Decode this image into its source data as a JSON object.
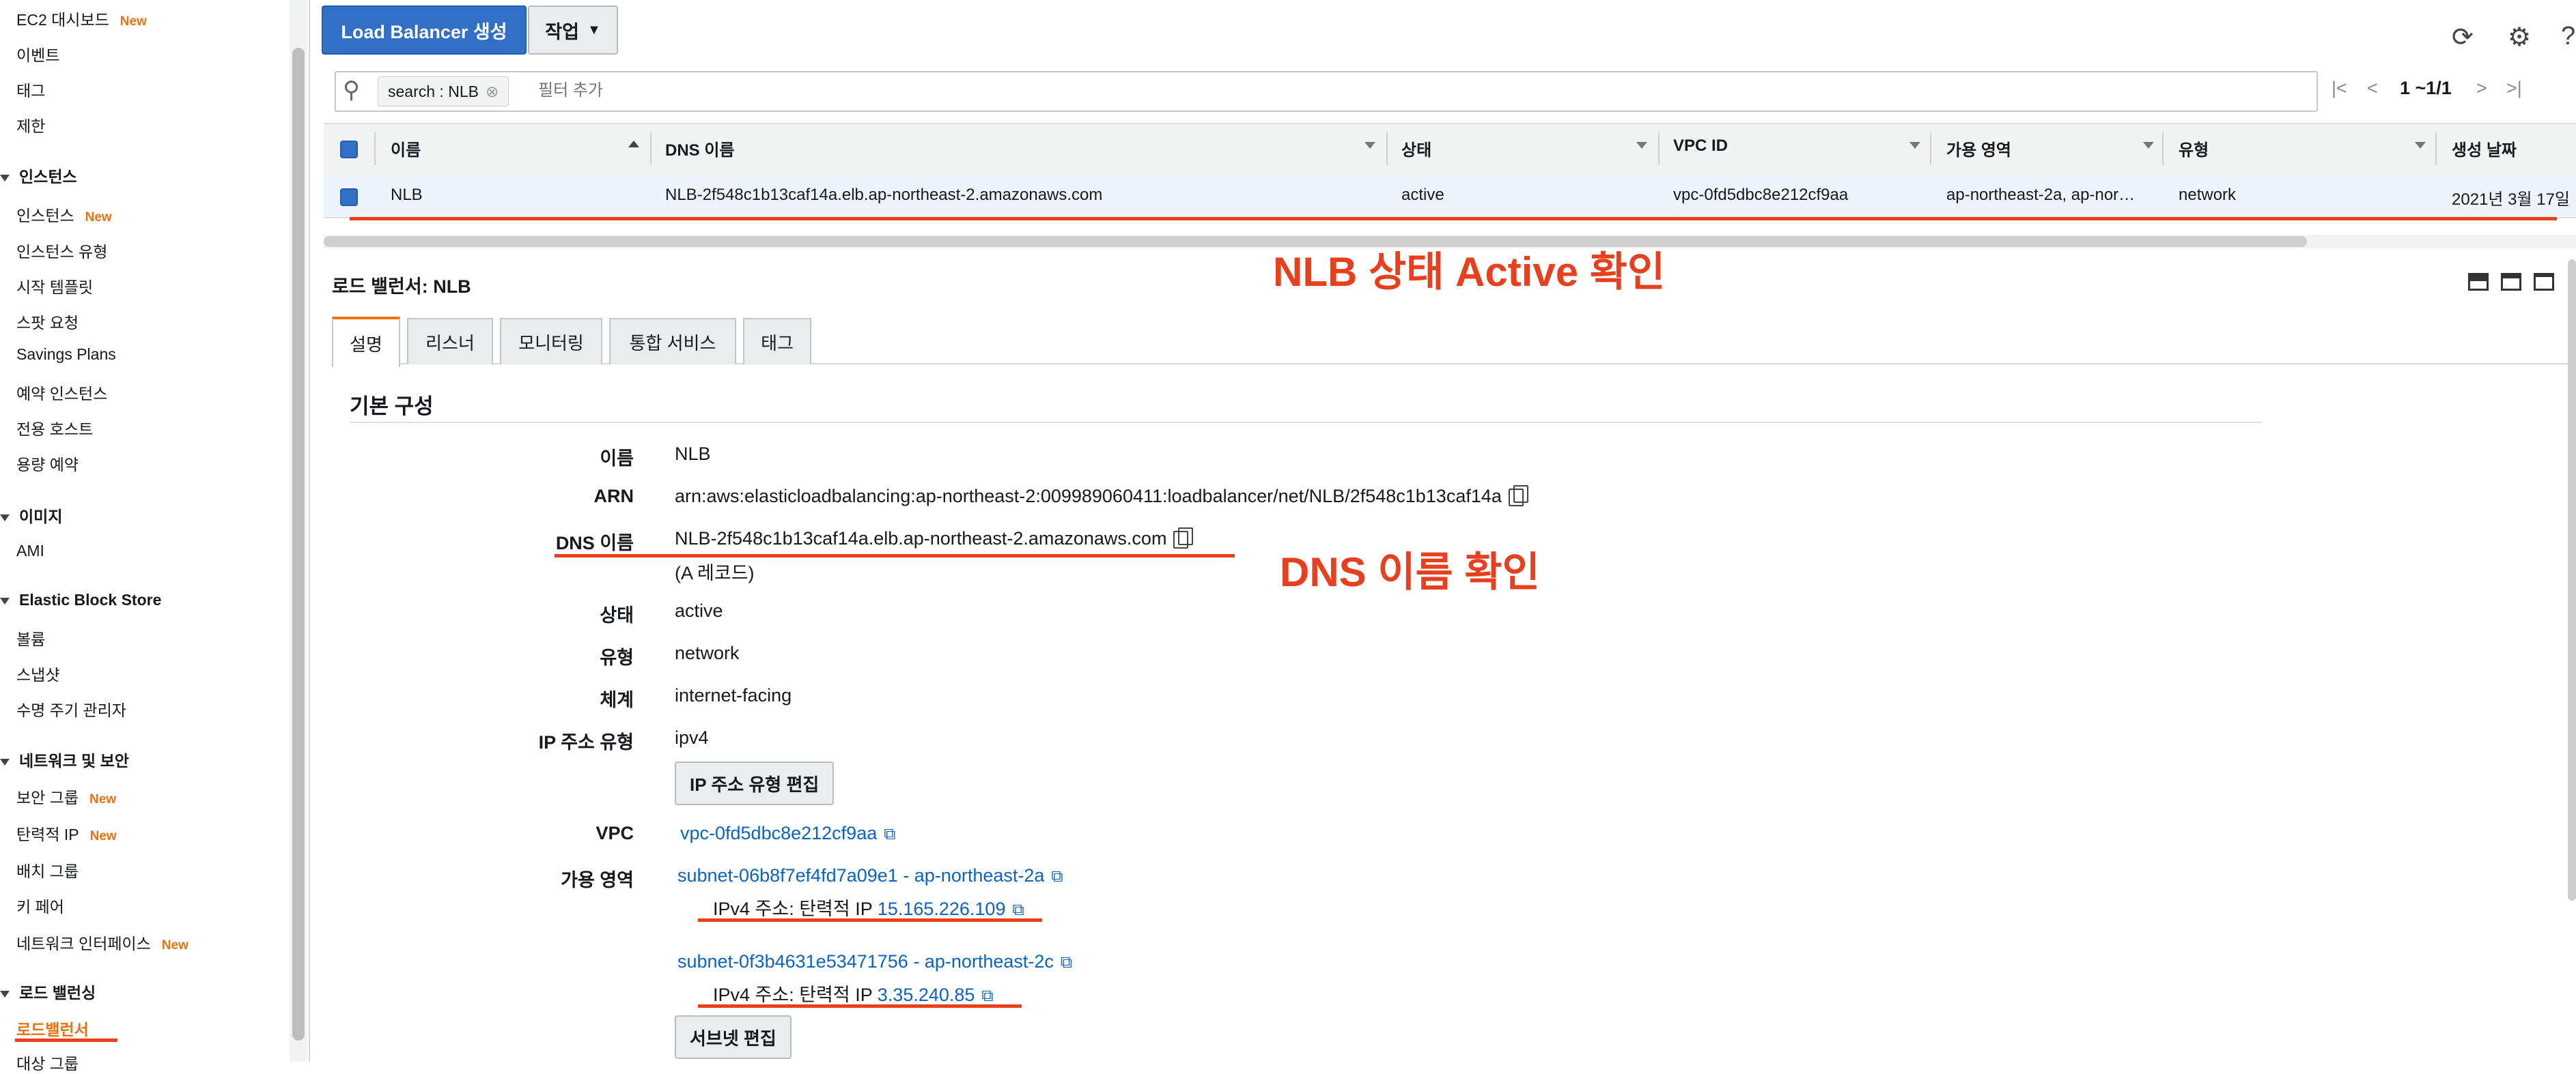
{
  "sidebar": {
    "items": [
      {
        "label": "EC2 대시보드",
        "badge": "New"
      },
      {
        "label": "이벤트"
      },
      {
        "label": "태그"
      },
      {
        "label": "제한"
      }
    ],
    "groups": [
      {
        "title": "인스턴스",
        "items": [
          {
            "label": "인스턴스",
            "badge": "New"
          },
          {
            "label": "인스턴스 유형"
          },
          {
            "label": "시작 템플릿"
          },
          {
            "label": "스팟 요청"
          },
          {
            "label": "Savings Plans"
          },
          {
            "label": "예약 인스턴스"
          },
          {
            "label": "전용 호스트"
          },
          {
            "label": "용량 예약"
          }
        ]
      },
      {
        "title": "이미지",
        "items": [
          {
            "label": "AMI"
          }
        ]
      },
      {
        "title": "Elastic Block Store",
        "items": [
          {
            "label": "볼륨"
          },
          {
            "label": "스냅샷"
          },
          {
            "label": "수명 주기 관리자"
          }
        ]
      },
      {
        "title": "네트워크 및 보안",
        "items": [
          {
            "label": "보안 그룹",
            "badge": "New"
          },
          {
            "label": "탄력적 IP",
            "badge": "New"
          },
          {
            "label": "배치 그룹"
          },
          {
            "label": "키 페어"
          },
          {
            "label": "네트워크 인터페이스",
            "badge": "New"
          }
        ]
      },
      {
        "title": "로드 밸런싱",
        "items": [
          {
            "label": "로드밸런서"
          },
          {
            "label": "대상 그룹"
          }
        ]
      }
    ]
  },
  "toolbar": {
    "create_label": "Load Balancer 생성",
    "actions_label": "작업"
  },
  "filter": {
    "token": "search : NLB",
    "placeholder": "필터 추가",
    "page": "1 ~1/1"
  },
  "table": {
    "headers": [
      "이름",
      "DNS 이름",
      "상태",
      "VPC ID",
      "가용 영역",
      "유형",
      "생성 날짜"
    ],
    "row": [
      "NLB",
      "NLB-2f548c1b13caf14a.elb.ap-northeast-2.amazonaws.com",
      "active",
      "vpc-0fd5dbc8e212cf9aa",
      "ap-northeast-2a, ap-nor…",
      "network",
      "2021년 3월 17일"
    ]
  },
  "annotations": {
    "state": "NLB 상태 Active 확인",
    "dns": "DNS 이름 확인"
  },
  "detail": {
    "title": "로드 밸런서: NLB",
    "tabs": [
      "설명",
      "리스너",
      "모니터링",
      "통합 서비스",
      "태그"
    ],
    "section": "기본 구성",
    "labels": {
      "name": "이름",
      "arn": "ARN",
      "dns": "DNS 이름",
      "state": "상태",
      "type": "유형",
      "scheme": "체계",
      "ip_type": "IP 주소 유형",
      "vpc": "VPC",
      "az": "가용 영역"
    },
    "values": {
      "name": "NLB",
      "arn": "arn:aws:elasticloadbalancing:ap-northeast-2:009989060411:loadbalancer/net/NLB/2f548c1b13caf14a",
      "dns": "NLB-2f548c1b13caf14a.elb.ap-northeast-2.amazonaws.com",
      "dns_note": "(A 레코드)",
      "state": "active",
      "type": "network",
      "scheme": "internet-facing",
      "ip_type": "ipv4",
      "ip_edit_button": "IP 주소 유형 편집",
      "vpc": "vpc-0fd5dbc8e212cf9aa",
      "subnet1": "subnet-06b8f7ef4fd7a09e1 - ap-northeast-2a",
      "ipv4_prefix": "IPv4 주소: 탄력적 IP",
      "ip1": "15.165.226.109",
      "subnet2": "subnet-0f3b4631e53471756 - ap-northeast-2c",
      "ip2": "3.35.240.85",
      "subnet_edit_button": "서브넷 편집"
    }
  },
  "colors": {
    "accent": "#ec7211",
    "primary": "#3170c6",
    "link": "#0b63c5",
    "annotation": "#e8401e"
  }
}
